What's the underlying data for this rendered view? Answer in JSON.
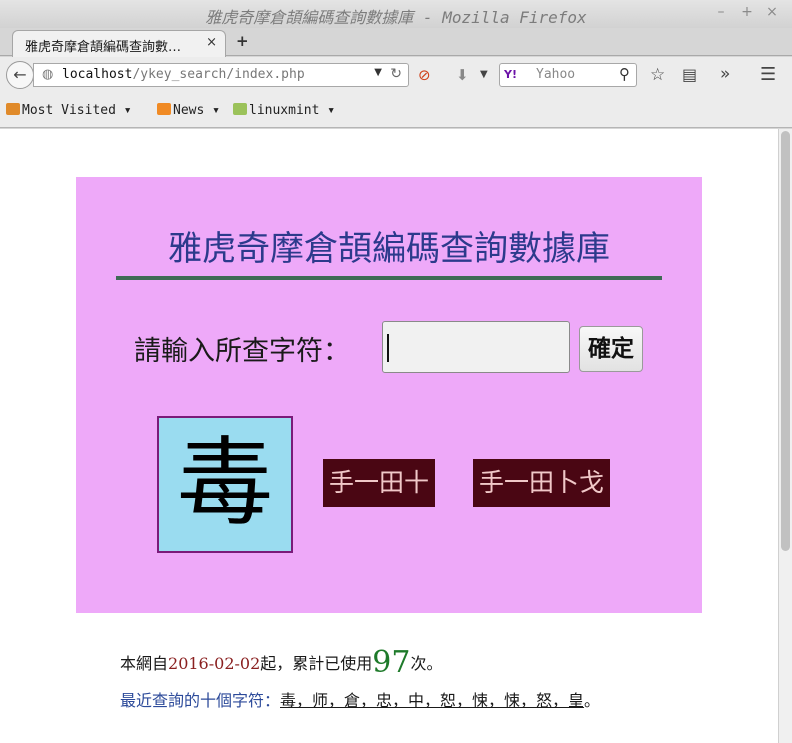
{
  "window": {
    "title": "雅虎奇摩倉頡編碼查詢數據庫 - Mozilla Firefox",
    "controls": {
      "minimize": "–",
      "maximize": "+",
      "close": "×"
    }
  },
  "tab": {
    "label": "雅虎奇摩倉頡編碼查詢數…",
    "close": "×",
    "new_tab": "+"
  },
  "nav": {
    "url_host": "localhost",
    "url_path": "/ykey_search/index.php",
    "search_engine": "Yahoo",
    "search_brand": "Y!"
  },
  "bookmarks": [
    {
      "label": "Most Visited",
      "icon": "folder-star-icon"
    },
    {
      "label": "News",
      "icon": "rss-icon"
    },
    {
      "label": "linuxmint",
      "icon": "folder-icon"
    }
  ],
  "page": {
    "title": "雅虎奇摩倉頡編碼查詢數據庫",
    "prompt": "請輸入所查字符：",
    "input_value": "",
    "submit_label": "確定",
    "result_char": "毒",
    "codes": [
      "手一田十",
      "手一田卜戈"
    ],
    "stats_prefix": "本網自",
    "stats_date": "2016-02-02",
    "stats_mid": "起，累計已使用",
    "stats_count": "97",
    "stats_suffix": "次。",
    "recent_label": "最近查詢的十個字符：",
    "recent_list": "毒，师，倉，忠，中，恕，悚，悚，怒，皇",
    "recent_end": "。"
  },
  "colors": {
    "panel_bg": "#eea9f9",
    "title_color": "#2c3a8c",
    "char_box_bg": "#9adcf0",
    "code_bg": "#4a0613"
  }
}
